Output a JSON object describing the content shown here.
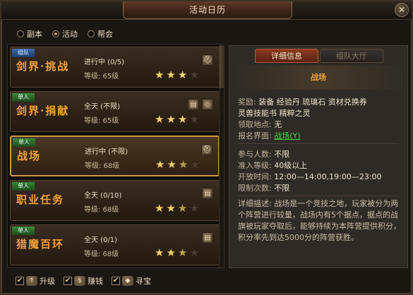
{
  "window": {
    "title": "活动日历",
    "close_label": "✕"
  },
  "filters": [
    {
      "label": "副本",
      "selected": false
    },
    {
      "label": "活动",
      "selected": true
    },
    {
      "label": "帮会",
      "selected": false
    }
  ],
  "activities": [
    {
      "tag": "组队",
      "tag_type": "team",
      "name": "剑界·挑战",
      "status": "进行中 (0/5)",
      "level": "等级: 65级",
      "stars": [
        1,
        1,
        1,
        0
      ],
      "icons": [
        "helmet-icon"
      ],
      "selected": false
    },
    {
      "tag": "单人",
      "tag_type": "solo",
      "name": "剑界·捐献",
      "status": "全天 (不限)",
      "level": "等级: 65级",
      "stars": [
        1,
        1,
        1,
        0
      ],
      "icons": [
        "scroll-icon",
        "coins-icon"
      ],
      "selected": false
    },
    {
      "tag": "单人",
      "tag_type": "solo",
      "name": "战场",
      "status": "进行中 (不限)",
      "level": "等级: 68级",
      "stars": [
        1,
        1,
        0.5,
        0
      ],
      "icons": [
        "helmet-icon"
      ],
      "selected": true
    },
    {
      "tag": "单人",
      "tag_type": "solo",
      "name": "职业任务",
      "status": "全天 (0/10)",
      "level": "等级: 68级",
      "stars": [
        1,
        1,
        0.5,
        0
      ],
      "icons": [
        "scroll-icon"
      ],
      "selected": false
    },
    {
      "tag": "单人",
      "tag_type": "solo",
      "name": "猎魔百环",
      "status": "全天 (0/1)",
      "level": "等级: 68级",
      "stars": [
        1,
        1,
        0.5,
        0
      ],
      "icons": [
        "scroll-icon"
      ],
      "selected": false
    }
  ],
  "detail": {
    "tabs": [
      {
        "label": "详细信息",
        "active": true
      },
      {
        "label": "组队大厅",
        "active": false
      }
    ],
    "activity_name": "战场",
    "reward_label": "奖励:",
    "reward_line1": "装备 经验丹 琉璃石 资材兑换券",
    "reward_line2": "灵兽技能书 精粹之灵",
    "location_label": "领取地点:",
    "location_value": "无",
    "signup_label": "报名界面:",
    "signup_value": "战场(Y)",
    "participants_label": "参与人数:",
    "participants_value": "不限",
    "level_label": "准入等级:",
    "level_value": "40级以上",
    "time_label": "开放时间:",
    "time_value": "12:00—14:00,19:00—23:00",
    "limit_label": "限制次数:",
    "limit_value": "不限",
    "description": "详细描述: 战场是一个竞技之地，玩家被分为两个阵营进行较量，战场内有5个据点，据点的战旗被玩家夺取后，能够持续为本阵营提供积分，积分率先到达5000分的阵营获胜。"
  },
  "bottom_checkboxes": [
    {
      "label": "升级",
      "checked": true,
      "icon": "upgrade-icon"
    },
    {
      "label": "赚钱",
      "checked": true,
      "icon": "money-bag-icon"
    },
    {
      "label": "寻宝",
      "checked": true,
      "icon": "treasure-icon"
    }
  ],
  "colors": {
    "accent": "#f0a03a",
    "link": "#4ad04a",
    "star": "#f0d26a",
    "tab_active": "#8a3a22"
  }
}
